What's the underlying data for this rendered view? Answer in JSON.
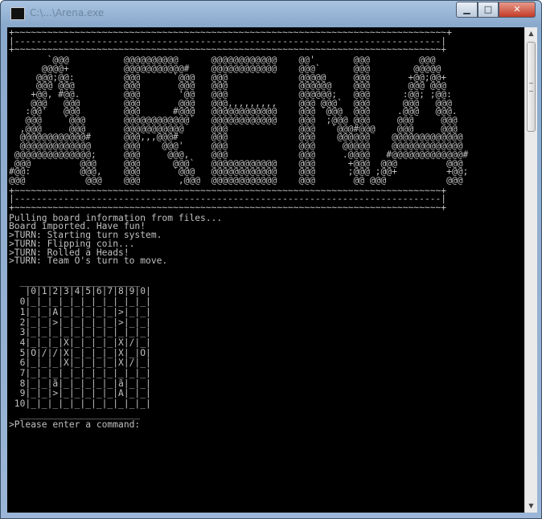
{
  "window": {
    "title": "C:\\...\\Arena.exe",
    "minimize_glyph": "▁",
    "maximize_glyph": "□",
    "close_glyph": "✕"
  },
  "scrollbar": {
    "up_glyph": "▲",
    "down_glyph": "▼"
  },
  "console": {
    "banner_top": "+~~~~~~~~~~~~~~~~~~~~~~~~~~~~~~~~~~~~~~~~~~~~~~~~~~~~~~~~~~~~~~~~~~~~~~~~~~~~~~~+\n|------------------------------------------------------------------------------|\n+~~~~~~~~~~~~~~~~~~~~~~~~~~~~~~~~~~~~~~~~~~~~~~~~~~~~~~~~~~~~~~~~~~~~~~~~~~~~~~+",
    "logo_art": "       `@@@          @@@@@@@@@@      @@@@@@@@@@@@    @@'       @@@         @@@\n      @@@@+          @@@@@@@@@@@#    @@@@@@@@@@@@    @@@`      @@@        @@@@@\n     @@@;@@:         @@@      `@@@   @@@             @@@@@     @@@       +@@;@@+\n     @@@ @@@         @@@       @@@   @@@             @@@@@@    @@@       @@@ @@@\n    +@@, #@@.        @@@       '@@   @@@             @@@@@@;   @@@      :@@; ;@@:\n    @@@   @@@        @@@       @@@   @@@,,,,,,,,,    @@@ @@@`  @@@      @@@   @@@\n   :@@'   @@@        @@@      #@@@   @@@@@@@@@@@@    @@@ `@@@  @@@     .@@@   @@@.\n   @@@    `@@@       @@@@@@@@@@@@`   @@@@@@@@@@@@    @@@  ;@@@ @@@     @@@     @@@\n  ,@@@     @@@       @@@@@@@@@@@     @@@             @@@   `@@@#@@@    @@@     @@@\n  @@@@@@@@@@@@#      @@@,,,@@@#      @@@             @@@    @@@@@@    @@@@@@@@@@@@@\n  @@@@@@@@@@@@@      @@@    @@@'     @@@             @@@     @@@@@    @@@@@@@@@@@@@\n @@@@@@@@@@@@@@;     @@@     @@@,    @@@             @@@     .@@@@   #@@@@@@@@@@@@@#\n @@@         @@@     @@@      @@@`   @@@@@@@@@@@@    @@@      +@@@  @@@         @@@\n#@@:         @@@,    @@@      `@@@   @@@@@@@@@@@@    @@@      ;@@@ ;@@+         +@@;\n@@@           @@@    @@@       ,@@@  @@@@@@@@@@@@    @@@       @@ @@@           @@@",
    "banner_bottom": "+~~~~~~~~~~~~~~~~~~~~~~~~~~~~~~~~~~~~~~~~~~~~~~~~~~~~~~~~~~~~~~~~~~~~~~~~~~~~~~+\n|------------------------------------------------------------------------------|\n+~~~~~~~~~~~~~~~~~~~~~~~~~~~~~~~~~~~~~~~~~~~~~~~~~~~~~~~~~~~~~~~~~~~~~~~~~~~~~~+",
    "log_lines": "Pulling board information from files...\nBoard imported. Have fun!\n>TURN: Starting turn system.\n>TURN: Flipping coin...\n>TURN: Rolled a Heads!\n>TURN: Team O's turn to move.",
    "board_top": "  ______________________",
    "board_header": "   |0|1|2|3|4|5|6|7|8|9|0|",
    "board_rows": [
      "  0|_|_|_|_|_|_|_|_|_|_|_|",
      "  1|_|_|A|_|_|_|_|_|>|_|_|",
      "  2|_|_|>|_|_|_|_|_|>|_|_|",
      "  3|_|_|_|_|_|_|_|_|_|_|_|",
      "  4|_|_|_|X|_|_|_|_|X|/|_|",
      "  5|O|/|/|X|_|_|_|_|X|_|O|",
      "  6|_|_|_|X|_|_|_|_|X|/|_|",
      "  7|_|_|_|_|_|_|_|_|_|_|_|",
      "  8|_|_|ã|_|_|_|_|_|ã|_|_|",
      "  9|_|_|>|_|_|_|_|_|A|_|_|",
      " 10|_|_|_|_|_|_|_|_|_|_|_|"
    ],
    "board_bottom": "  ______________________",
    "prompt": ">Please enter a command:"
  }
}
